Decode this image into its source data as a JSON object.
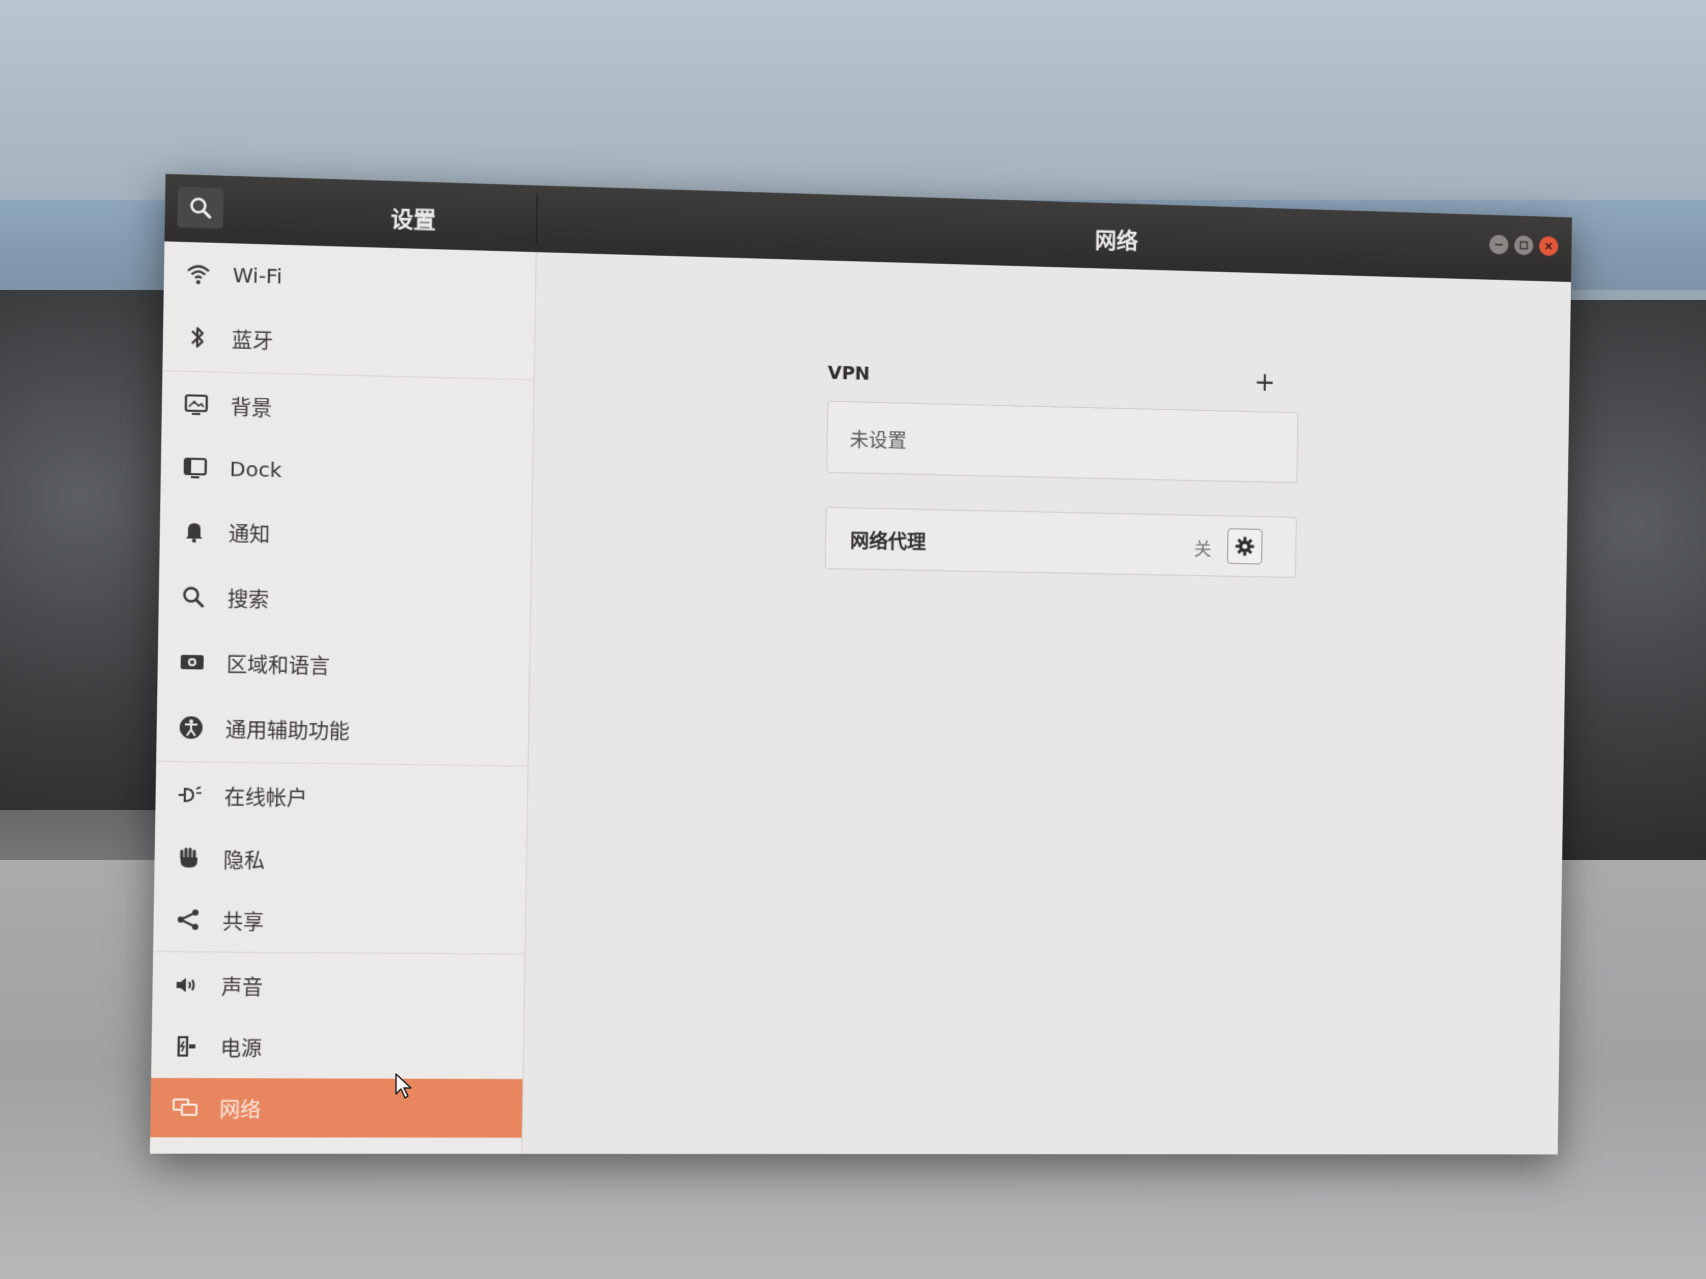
{
  "titlebar": {
    "settings_title": "设置",
    "panel_title": "网络"
  },
  "sidebar": {
    "items": [
      {
        "label": "Wi-Fi",
        "icon": "wifi-icon"
      },
      {
        "label": "蓝牙",
        "icon": "bluetooth-icon"
      },
      {
        "label": "背景",
        "icon": "background-icon"
      },
      {
        "label": "Dock",
        "icon": "dock-icon"
      },
      {
        "label": "通知",
        "icon": "bell-icon"
      },
      {
        "label": "搜索",
        "icon": "search-icon"
      },
      {
        "label": "区域和语言",
        "icon": "region-icon"
      },
      {
        "label": "通用辅助功能",
        "icon": "accessibility-icon"
      },
      {
        "label": "在线帐户",
        "icon": "online-accounts-icon"
      },
      {
        "label": "隐私",
        "icon": "privacy-hand-icon"
      },
      {
        "label": "共享",
        "icon": "share-icon"
      },
      {
        "label": "声音",
        "icon": "speaker-icon"
      },
      {
        "label": "电源",
        "icon": "power-icon"
      },
      {
        "label": "网络",
        "icon": "network-icon",
        "active": true
      }
    ]
  },
  "main": {
    "vpn": {
      "label": "VPN",
      "add_symbol": "+",
      "empty_text": "未设置"
    },
    "proxy": {
      "label": "网络代理",
      "state": "关"
    }
  },
  "colors": {
    "accent": "#e8875f",
    "titlebar": "#2f2d2b",
    "close_button": "#e3573b"
  }
}
